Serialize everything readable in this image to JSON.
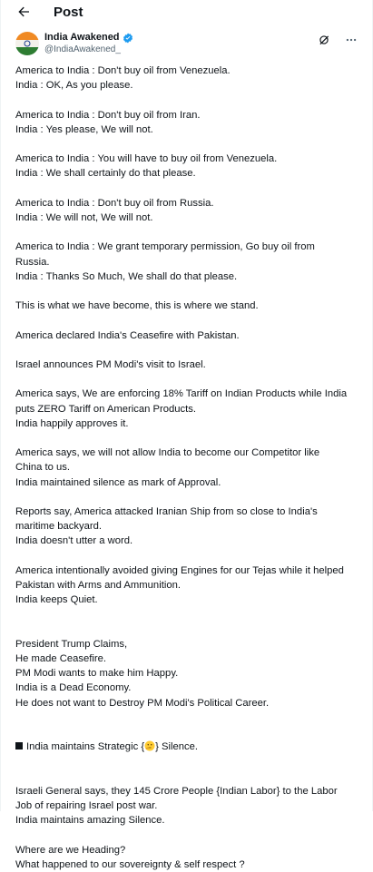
{
  "topbar": {
    "title": "Post"
  },
  "author": {
    "name": "India Awakened",
    "handle": "@IndiaAwakened_"
  },
  "icons": {
    "back": "arrow-left-icon",
    "verified": "verified-badge-icon",
    "grok": "grok-icon",
    "more": "more-horizontal-icon",
    "thinking_face": "thinking-face-emoji",
    "square": "black-square-emoji"
  },
  "colors": {
    "verified": "#1d9bf0",
    "text": "#0f1419",
    "muted": "#536471"
  },
  "post": {
    "paragraphs": [
      "America to India : Don't buy oil from Venezuela.\nIndia : OK, As you please.",
      "America to India : Don't buy oil from Iran.\nIndia : Yes please, We will not.",
      "America to India : You will have to buy oil from Venezuela.\nIndia : We shall certainly do that please.",
      "America to India : Don't buy oil from Russia.\nIndia : We will not, We will not.",
      "America to India : We grant temporary permission, Go buy oil from\nRussia.\nIndia : Thanks So Much, We shall do that please.",
      "This is what we have become, this is where we stand.",
      "America declared India's Ceasefire with Pakistan.",
      "Israel announces PM Modi's visit to Israel.",
      "America says, We are enforcing 18% Tariff on Indian Products while India\nputs ZERO Tariff on American Products.\nIndia happily approves it.",
      "America says, we will not allow India to become our Competitor like\nChina to us.\nIndia maintained silence as mark of Approval.",
      "Reports say, America attacked Iranian Ship from so close to India's\nmaritime backyard.\nIndia doesn't utter a word.",
      "America intentionally avoided giving Engines for our Tejas while it helped\nPakistan with Arms and Ammunition.\nIndia keeps Quiet."
    ],
    "trump_paragraph": "President Trump Claims,\nHe made Ceasefire.\nPM Modi wants to make him Happy.\nIndia is a Dead Economy.\nHe does not want to Destroy PM Modi's Political Career.",
    "strategic_prefix": "India maintains Strategic {",
    "strategic_suffix": "} Silence.",
    "israel_paragraph": "Israeli General says, they 145 Crore People {Indian Labor} to the Labor\nJob of repairing Israel post war.\nIndia maintains amazing Silence.",
    "closing_paragraph": "Where are we Heading?\nWhat happened to our sovereignty & self respect ?"
  }
}
